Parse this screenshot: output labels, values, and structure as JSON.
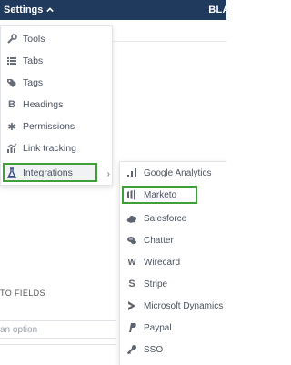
{
  "topbar": {
    "settings_label": "Settings",
    "right_text": "BLAC"
  },
  "page": {
    "fields_label": "TO FIELDS",
    "option_placeholder": "an option"
  },
  "settings_menu": {
    "items": [
      {
        "label": "Tools",
        "icon": "wrench-icon"
      },
      {
        "label": "Tabs",
        "icon": "list-icon"
      },
      {
        "label": "Tags",
        "icon": "tags-icon"
      },
      {
        "label": "Headings",
        "icon": "bold-b-icon"
      },
      {
        "label": "Permissions",
        "icon": "asterisk-icon"
      },
      {
        "label": "Link tracking",
        "icon": "chart-icon"
      },
      {
        "label": "Integrations",
        "icon": "flask-icon",
        "selected": true
      }
    ]
  },
  "integrations_menu": {
    "items": [
      {
        "label": "Google Analytics",
        "icon": "bar-chart-icon"
      },
      {
        "label": "Marketo",
        "icon": "marketo-icon",
        "selected": true
      },
      {
        "label": "Salesforce",
        "icon": "cloud-icon"
      },
      {
        "label": "Chatter",
        "icon": "chat-icon"
      },
      {
        "label": "Wirecard",
        "icon": "wirecard-icon"
      },
      {
        "label": "Stripe",
        "icon": "stripe-icon"
      },
      {
        "label": "Microsoft Dynamics",
        "icon": "dynamics-icon"
      },
      {
        "label": "Paypal",
        "icon": "paypal-icon"
      },
      {
        "label": "SSO",
        "icon": "key-icon"
      }
    ]
  },
  "colors": {
    "topbar": "#1f3a5c",
    "highlight": "#3fa03a",
    "text": "#4a5361"
  }
}
